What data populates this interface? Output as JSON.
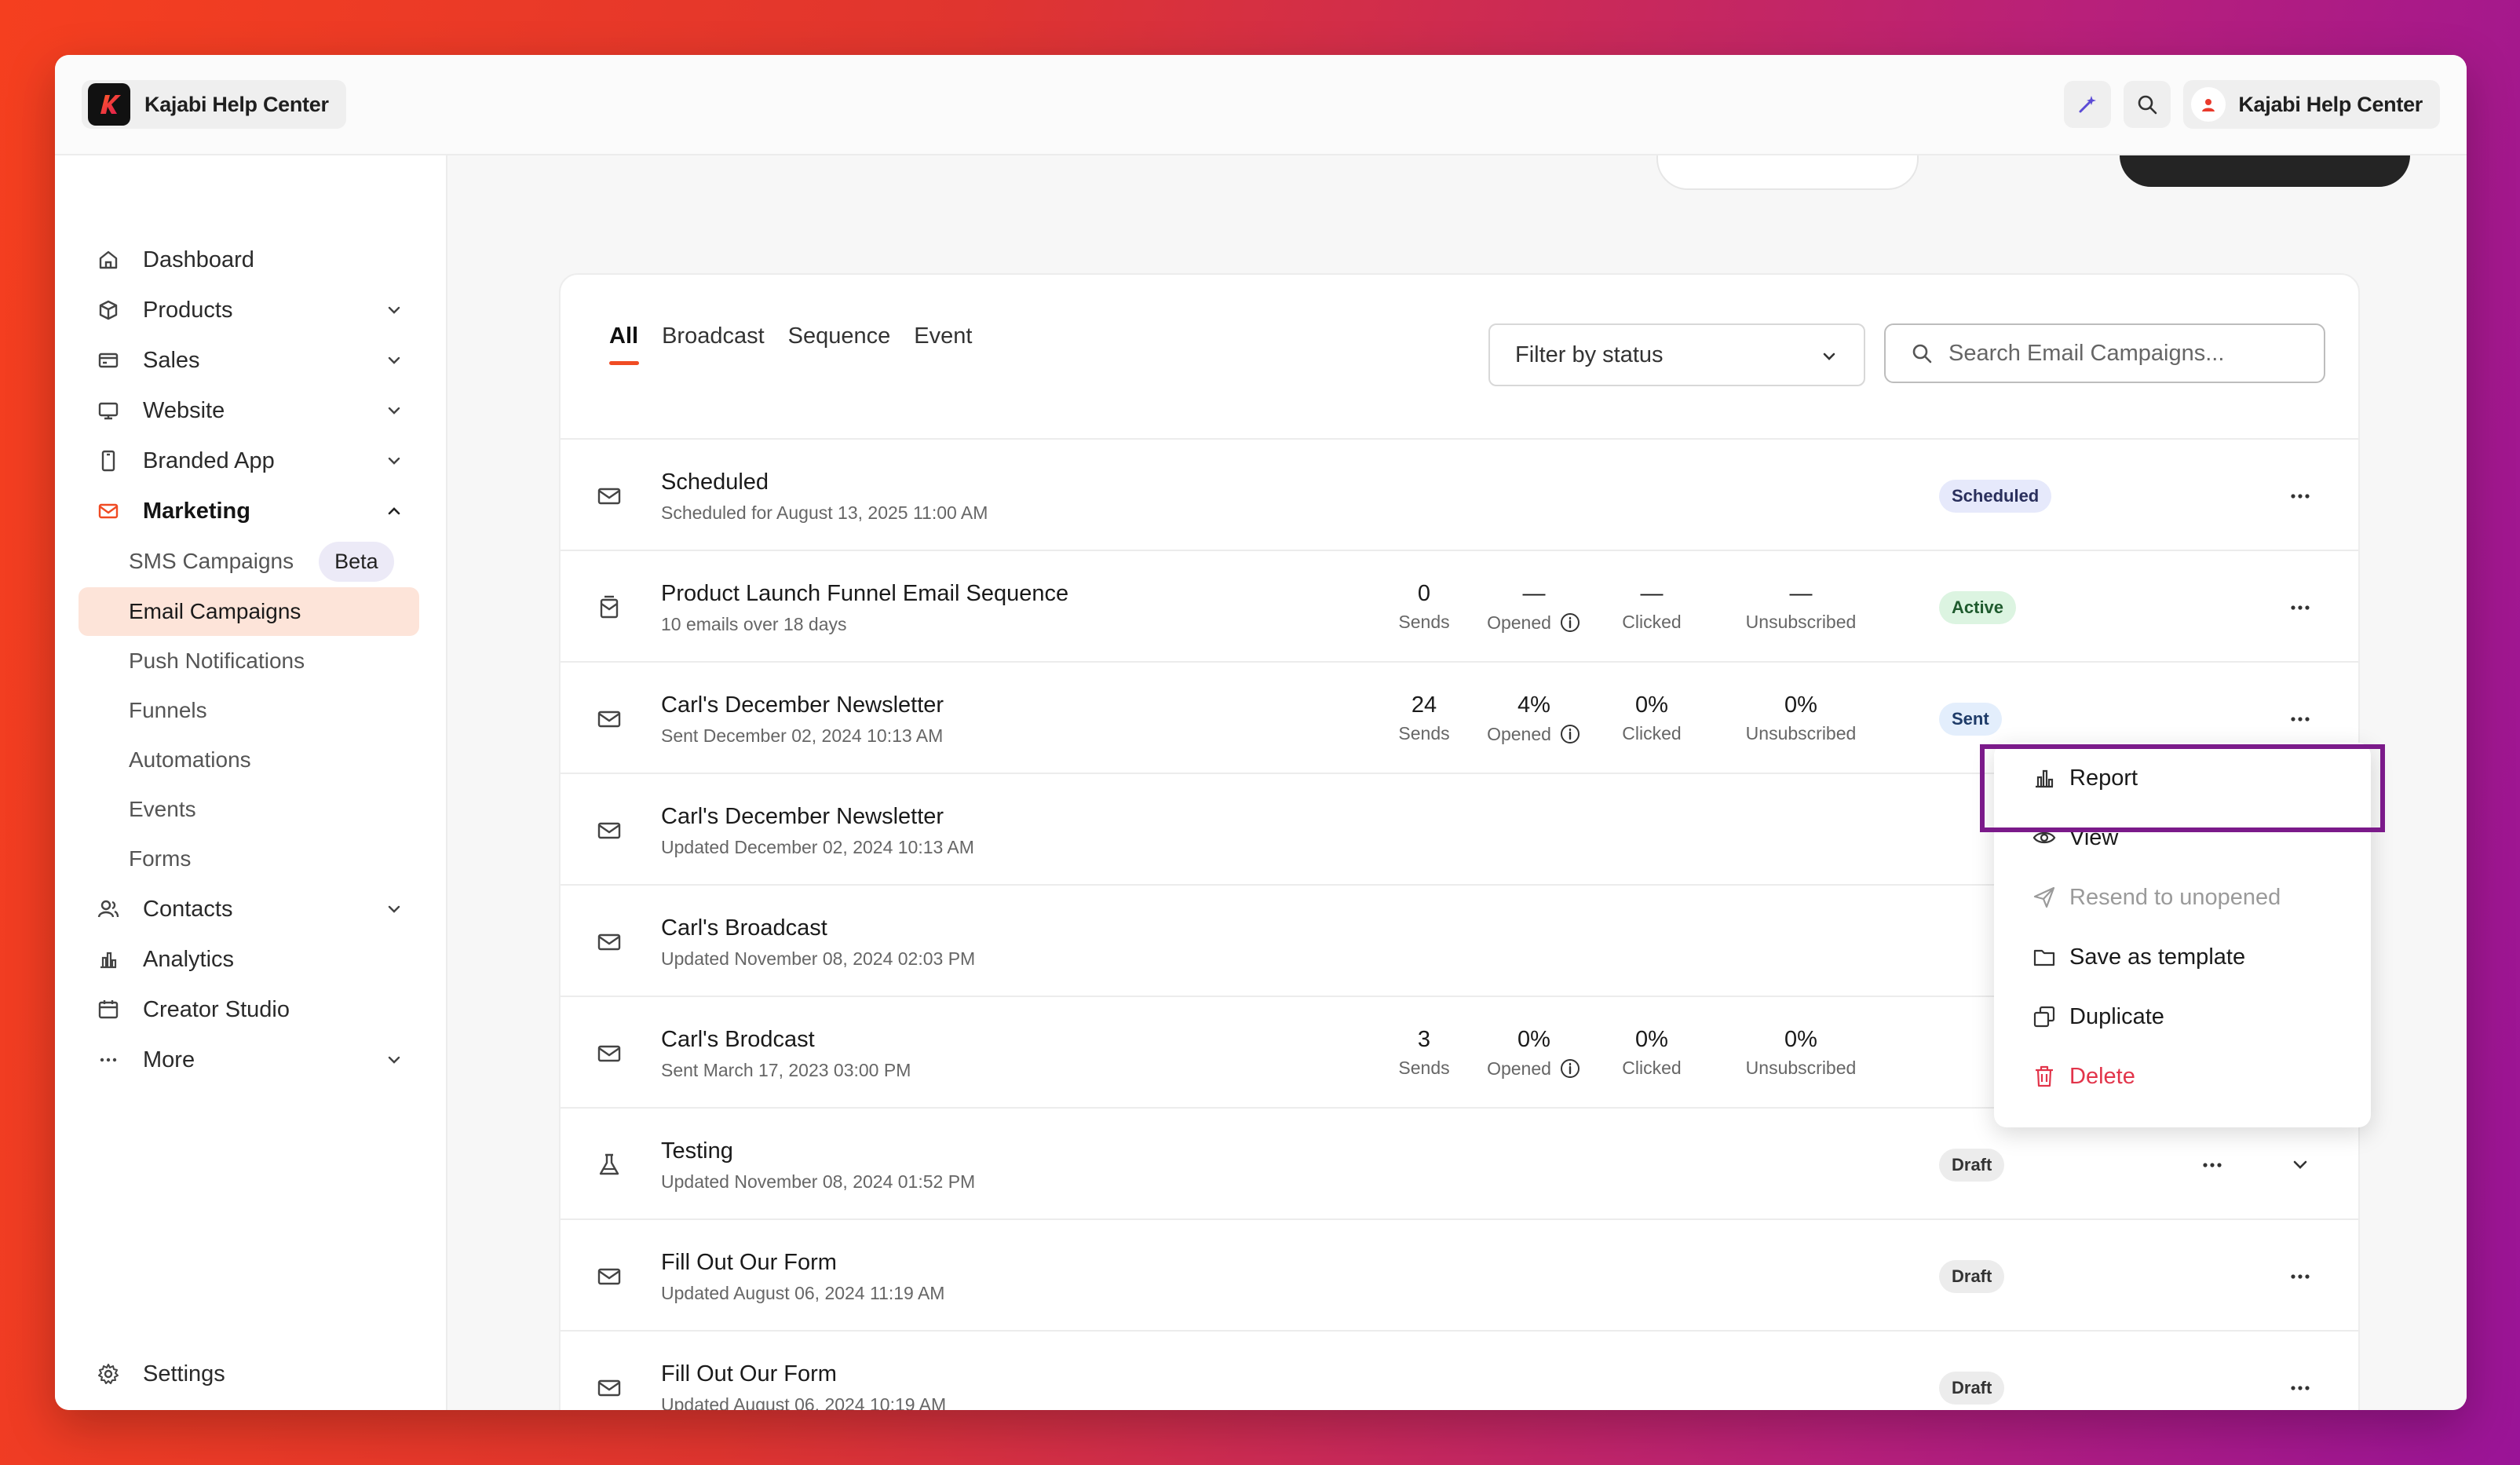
{
  "brand": {
    "name": "Kajabi Help Center",
    "logo_letter": "k"
  },
  "account": {
    "name": "Kajabi Help Center"
  },
  "sidebar": {
    "items": [
      {
        "label": "Dashboard"
      },
      {
        "label": "Products"
      },
      {
        "label": "Sales"
      },
      {
        "label": "Website"
      },
      {
        "label": "Branded App"
      },
      {
        "label": "Marketing"
      },
      {
        "label": "Contacts"
      },
      {
        "label": "Analytics"
      },
      {
        "label": "Creator Studio"
      },
      {
        "label": "More"
      },
      {
        "label": "Settings"
      }
    ],
    "marketing_sub": [
      {
        "label": "SMS Campaigns",
        "badge": "Beta"
      },
      {
        "label": "Email Campaigns"
      },
      {
        "label": "Push Notifications"
      },
      {
        "label": "Funnels"
      },
      {
        "label": "Automations"
      },
      {
        "label": "Events"
      },
      {
        "label": "Forms"
      }
    ]
  },
  "tabs": [
    "All",
    "Broadcast",
    "Sequence",
    "Event"
  ],
  "filter": {
    "label": "Filter by status"
  },
  "search": {
    "placeholder": "Search Email Campaigns..."
  },
  "stat_labels": {
    "sends": "Sends",
    "opened": "Opened",
    "clicked": "Clicked",
    "unsubscribed": "Unsubscribed"
  },
  "rows": [
    {
      "title": "Scheduled",
      "subtitle": "Scheduled for August 13, 2025 11:00 AM",
      "status": "Scheduled"
    },
    {
      "title": "Product Launch Funnel Email Sequence",
      "subtitle": "10 emails over 18 days",
      "sends": "0",
      "opened": "—",
      "clicked": "—",
      "unsubscribed": "—",
      "status": "Active"
    },
    {
      "title": "Carl's December Newsletter",
      "subtitle": "Sent December 02, 2024 10:13 AM",
      "sends": "24",
      "opened": "4%",
      "clicked": "0%",
      "unsubscribed": "0%",
      "status": "Sent"
    },
    {
      "title": "Carl's December Newsletter",
      "subtitle": "Updated December 02, 2024 10:13 AM"
    },
    {
      "title": "Carl's Broadcast",
      "subtitle": "Updated November 08, 2024 02:03 PM"
    },
    {
      "title": "Carl's Brodcast",
      "subtitle": "Sent March 17, 2023 03:00 PM",
      "sends": "3",
      "opened": "0%",
      "clicked": "0%",
      "unsubscribed": "0%"
    },
    {
      "title": "Testing",
      "subtitle": "Updated November 08, 2024 01:52 PM",
      "status": "Draft"
    },
    {
      "title": "Fill Out Our Form",
      "subtitle": "Updated August 06, 2024 11:19 AM",
      "status": "Draft"
    },
    {
      "title": "Fill Out Our Form",
      "subtitle": "Updated August 06, 2024 10:19 AM",
      "status": "Draft"
    }
  ],
  "menu": {
    "items": [
      {
        "label": "Report",
        "icon": "bar-chart-icon"
      },
      {
        "label": "View",
        "icon": "eye-icon"
      },
      {
        "label": "Resend to unopened",
        "icon": "send-icon",
        "disabled": true
      },
      {
        "label": "Save as template",
        "icon": "folder-icon"
      },
      {
        "label": "Duplicate",
        "icon": "copy-icon"
      },
      {
        "label": "Delete",
        "icon": "trash-icon",
        "danger": true
      }
    ]
  },
  "colors": {
    "accent": "#f04b23",
    "active_nav_bg": "#fde4d9",
    "highlight": "#7b1a8a",
    "danger": "#e2344a"
  }
}
